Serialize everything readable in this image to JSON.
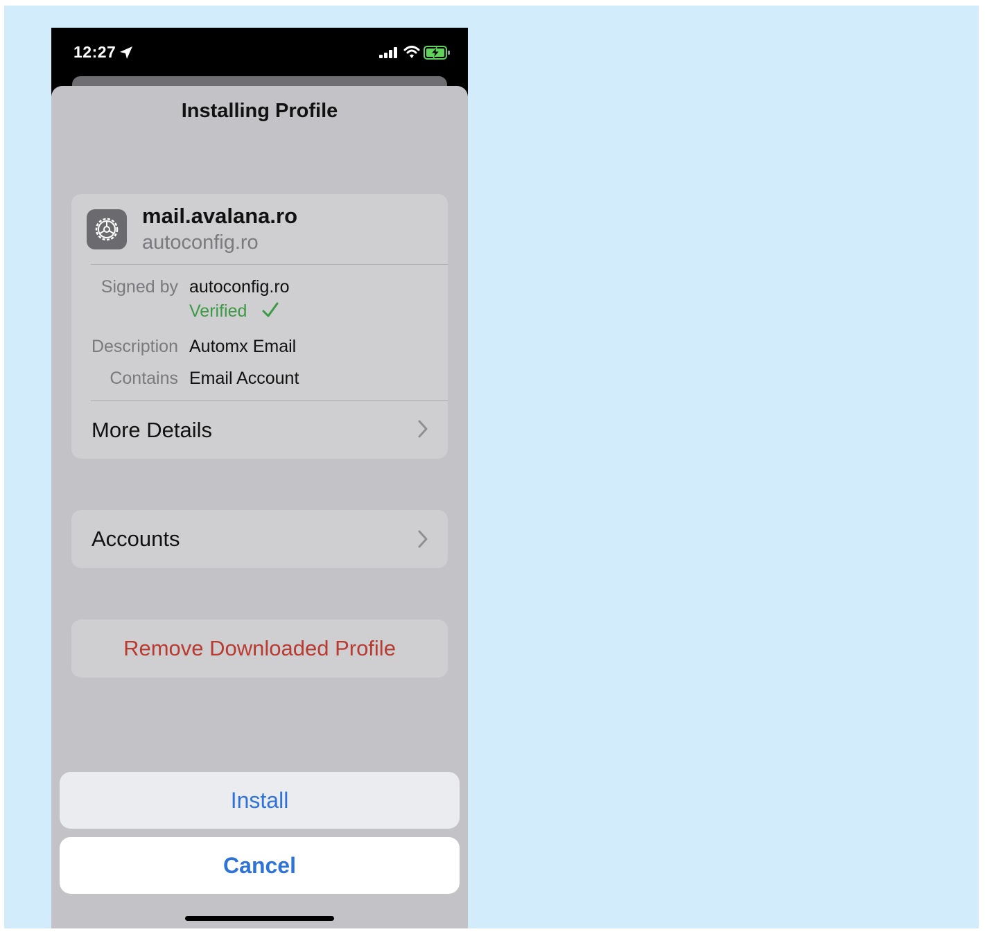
{
  "status_bar": {
    "time": "12:27",
    "icons": [
      "location-arrow-icon",
      "cellular-signal-icon",
      "wifi-icon",
      "battery-charging-icon"
    ]
  },
  "sheet": {
    "title": "Installing Profile"
  },
  "profile": {
    "icon": "gear-icon",
    "name": "mail.avalana.ro",
    "subtitle": "autoconfig.ro",
    "signed_by_label": "Signed by",
    "signed_by_value": "autoconfig.ro",
    "verified_text": "Verified",
    "description_label": "Description",
    "description_value": "Automx Email",
    "contains_label": "Contains",
    "contains_value": "Email Account",
    "more_details_label": "More Details"
  },
  "accounts": {
    "label": "Accounts"
  },
  "remove": {
    "label": "Remove Downloaded Profile"
  },
  "actions": {
    "install_label": "Install",
    "cancel_label": "Cancel"
  },
  "colors": {
    "canvas_bg": "#d3ecfb",
    "sheet_bg": "#c2c2c7",
    "card_bg": "#cfcfd1",
    "accent_blue": "#2f73d6",
    "verified_green": "#3c9a44",
    "destructive_red": "#b83a30",
    "battery_green": "#5fd35a"
  }
}
